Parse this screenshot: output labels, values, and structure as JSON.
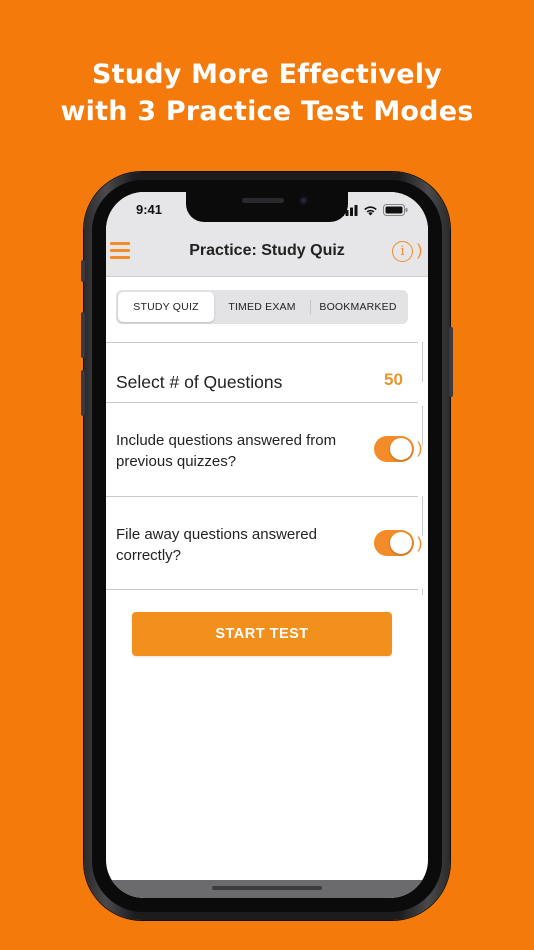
{
  "headline": {
    "line1": "Study More Effectively",
    "line2": "with 3 Practice Test Modes"
  },
  "status_bar": {
    "time": "9:41",
    "icons": [
      "signal-icon",
      "wifi-icon",
      "battery-icon"
    ]
  },
  "nav": {
    "title": "Practice: Study Quiz",
    "info_glyph": "i",
    "menu_icon": "hamburger-menu-icon"
  },
  "tabs": [
    {
      "label": "STUDY QUIZ",
      "selected": true
    },
    {
      "label": "TIMED EXAM",
      "selected": false
    },
    {
      "label": "BOOKMARKED",
      "selected": false
    }
  ],
  "questions": {
    "label": "Select # of Questions",
    "value": "50"
  },
  "options": [
    {
      "label": "Include questions answered from previous quizzes?",
      "enabled": true
    },
    {
      "label": "File away questions answered correctly?",
      "enabled": true
    }
  ],
  "start_button": {
    "label": "START TEST"
  },
  "colors": {
    "background": "#F47A0C",
    "accent": "#F28C28",
    "value_text": "#E7962F"
  }
}
